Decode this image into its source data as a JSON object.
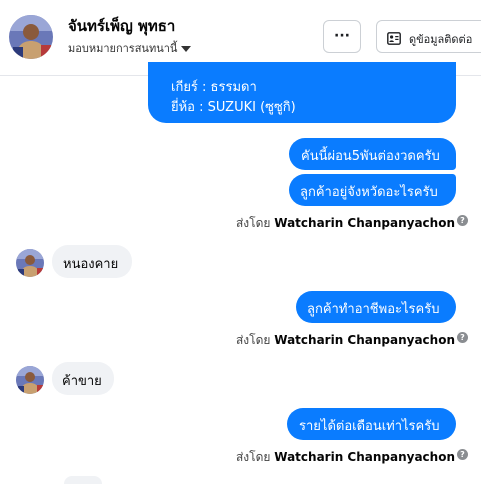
{
  "header": {
    "contact_name": "จันทร์เพ็ญ พุทธา",
    "assign_label": "มอบหมายการสนทนานี้",
    "more_label": "···",
    "contact_info_label": "ดูข้อมูลติดต่อ"
  },
  "messages": {
    "top_bubble": {
      "line1": "เกียร์ : ธรรมดา",
      "line2": "ยี่ห้อ : SUZUKI (ซูซูกิ)"
    },
    "out1": "คันนี้ผ่อน5พันต่องวดครับ",
    "out2": "ลูกค้าอยู่จังหวัดอะไรครับ",
    "sent1": {
      "prefix": "ส่งโดย",
      "agent": "Watcharin Chanpanyachon"
    },
    "in1": "หนองคาย",
    "out3": "ลูกค้าทำอาชีพอะไรครับ",
    "sent2": {
      "prefix": "ส่งโดย",
      "agent": "Watcharin Chanpanyachon"
    },
    "in2": "ค้าขาย",
    "out4": "รายได้ต่อเดือนเท่าไรครับ",
    "sent3": {
      "prefix": "ส่งโดย",
      "agent": "Watcharin Chanpanyachon"
    }
  },
  "colors": {
    "outgoing_bubble": "#0a7cff",
    "incoming_bubble": "#f0f2f5"
  }
}
